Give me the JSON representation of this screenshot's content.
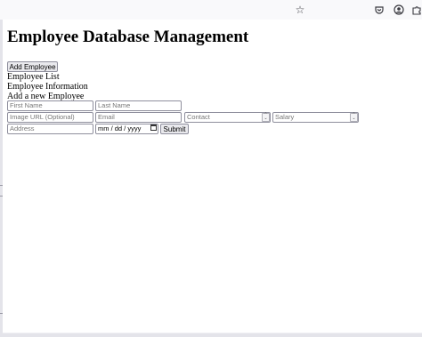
{
  "page": {
    "title": "Employee Database Management",
    "add_button": "Add Employee",
    "list_heading": "Employee List",
    "info_heading": "Employee Information",
    "add_heading": "Add a new Employee",
    "form": {
      "first_name_placeholder": "First Name",
      "last_name_placeholder": "Last Name",
      "image_url_placeholder": "Image URL (Optional)",
      "email_placeholder": "Email",
      "contact_placeholder": "Contact",
      "salary_placeholder": "Salary",
      "address_placeholder": "Address",
      "date_placeholder": "mm / dd / yyyy",
      "submit_label": "Submit"
    }
  },
  "browser": {
    "icons": [
      "bookmark-star-icon",
      "pocket-icon",
      "account-icon",
      "extensions-icon"
    ]
  }
}
